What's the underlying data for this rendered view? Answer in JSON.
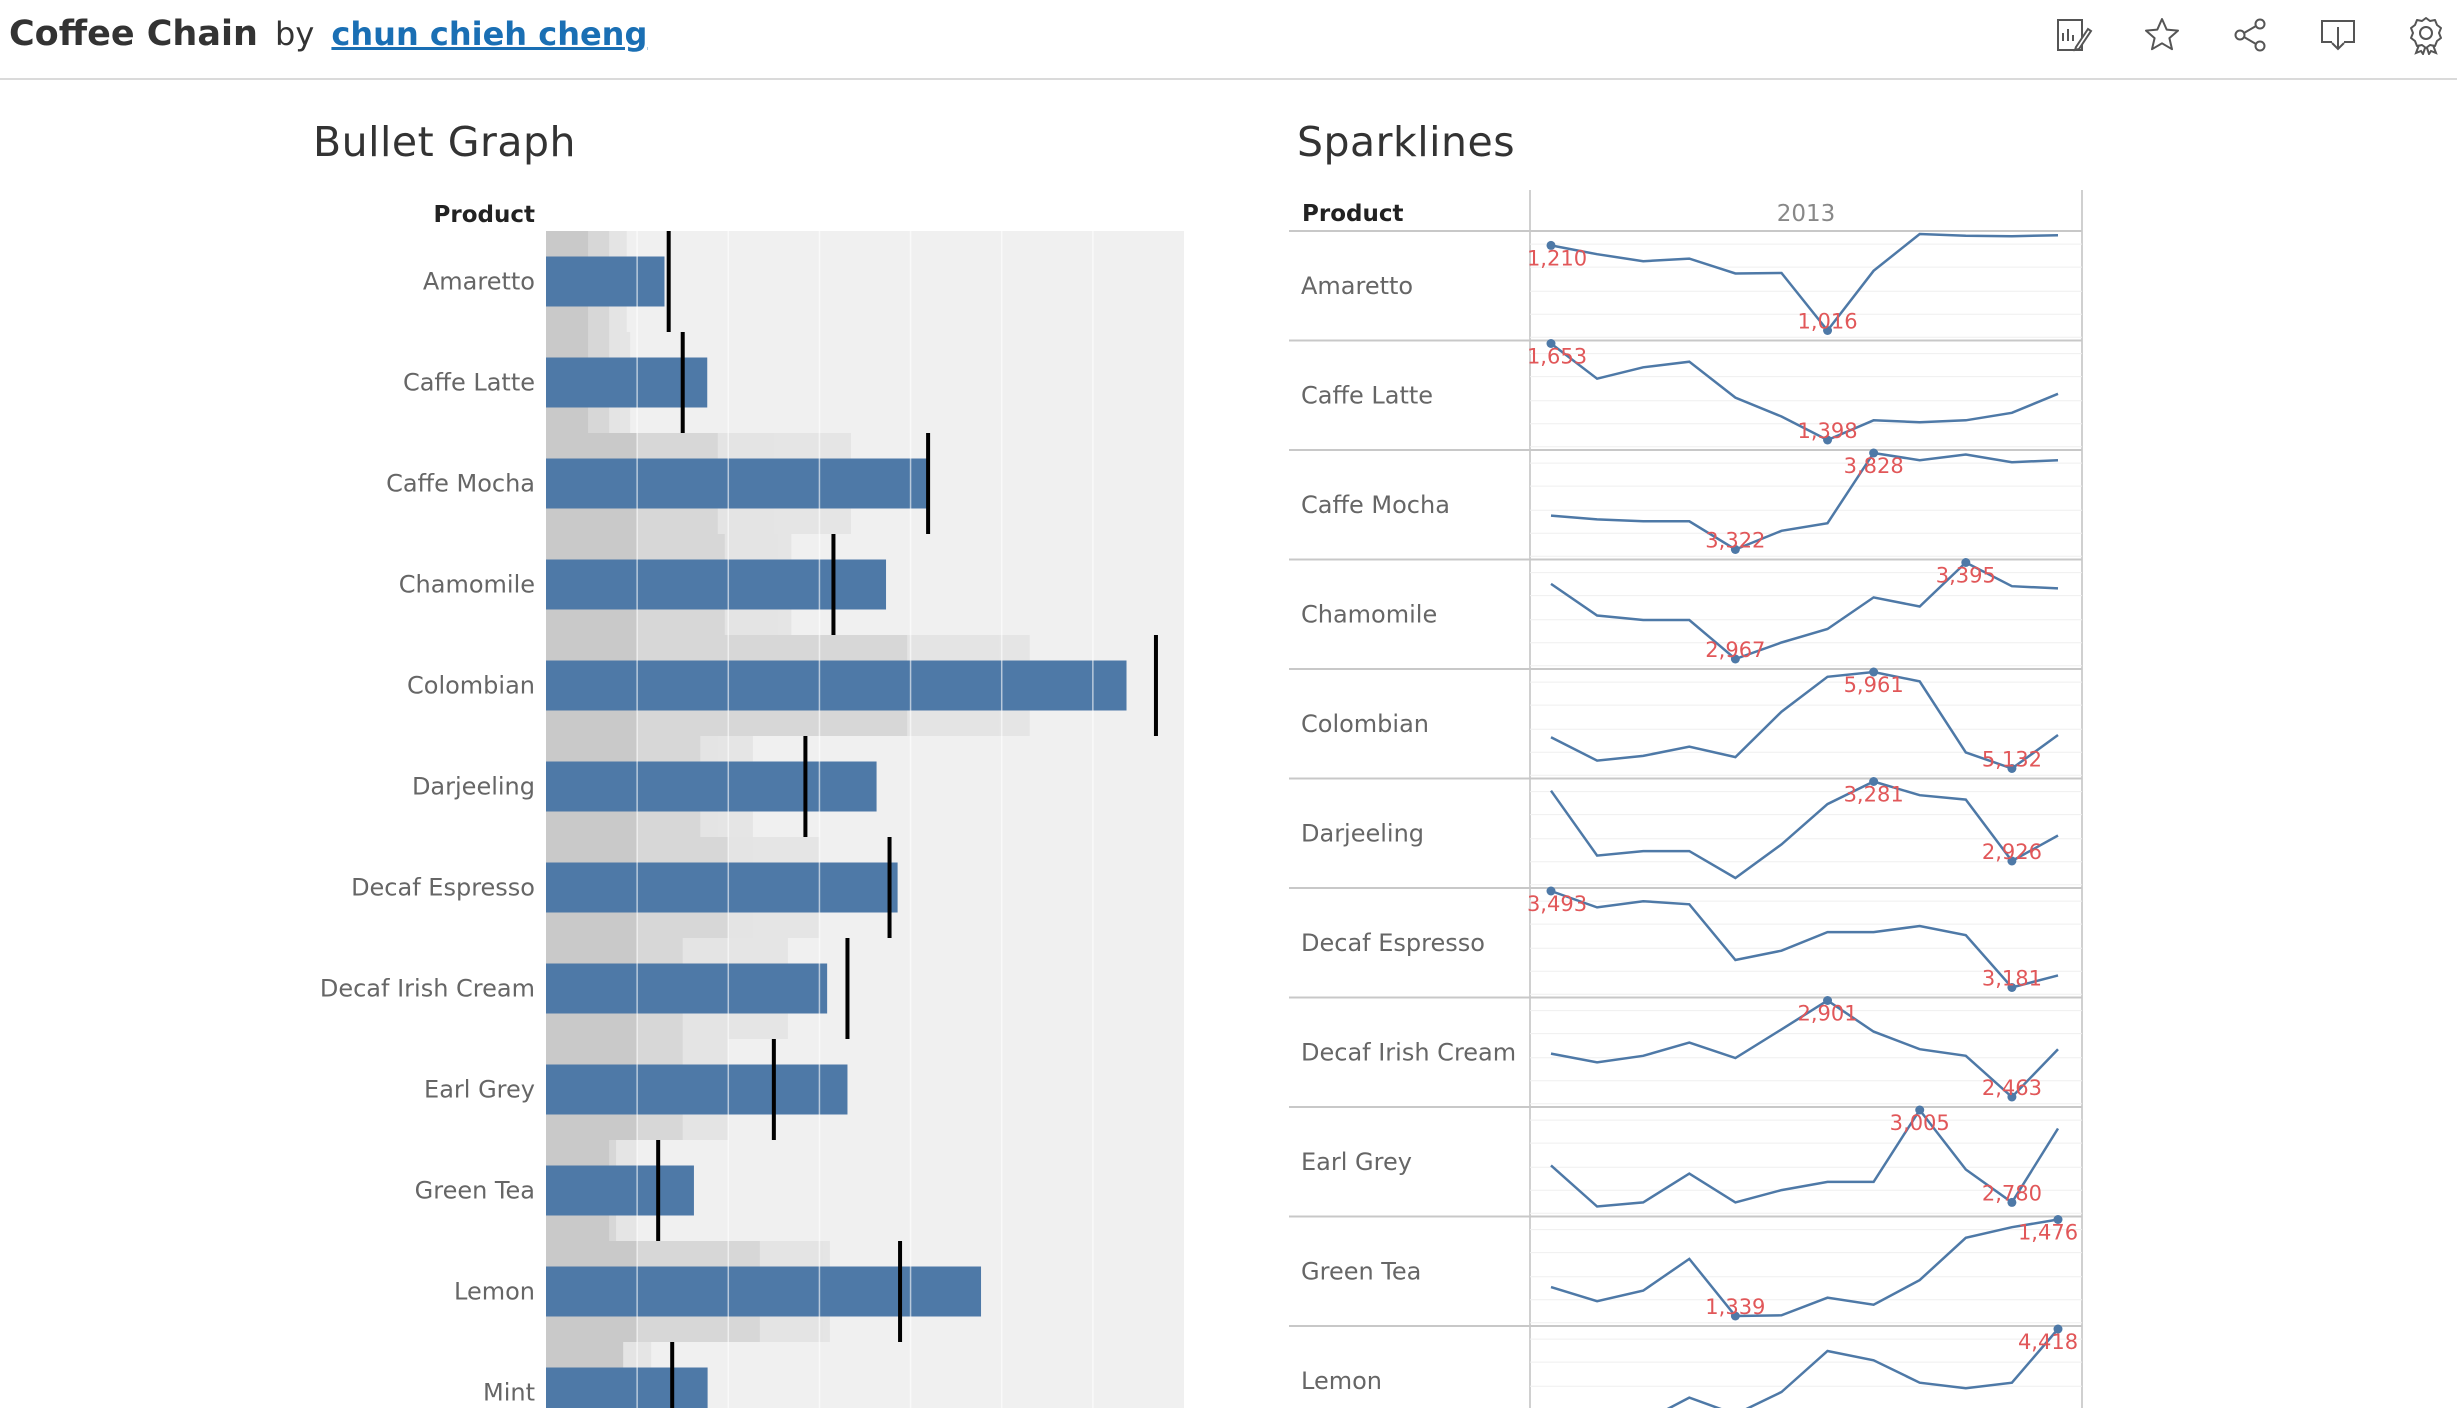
{
  "header": {
    "title": "Coffee Chain",
    "by": "by",
    "author": "chun chieh cheng",
    "tools": [
      "edit-icon",
      "star-icon",
      "share-icon",
      "download-icon",
      "badge-icon"
    ]
  },
  "chart_data": [
    {
      "type": "bar",
      "subtype": "bullet",
      "title": "Bullet Graph",
      "row_header": "Product",
      "categories": [
        "Amaretto",
        "Caffe Latte",
        "Caffe Mocha",
        "Chamomile",
        "Colombian",
        "Darjeeling",
        "Decaf Espresso",
        "Decaf Irish Cream",
        "Earl Grey",
        "Green Tea",
        "Lemon",
        "Mint"
      ],
      "series": [
        {
          "values": [
            33800,
            46000,
            108600,
            97000,
            165600,
            94300,
            100300,
            80200,
            86000,
            42200,
            124100,
            46100
          ]
        }
      ],
      "targets": [
        35000,
        39000,
        109000,
        82000,
        174000,
        74000,
        98000,
        86000,
        65000,
        32000,
        101000,
        36000
      ],
      "bands": [
        [
          12000,
          18000,
          21000,
          23000
        ],
        [
          12000,
          18000,
          21000,
          24000
        ],
        [
          26000,
          49000,
          65000,
          87000
        ],
        [
          26000,
          51000,
          66000,
          70000
        ],
        [
          26000,
          103000,
          129000,
          138000
        ],
        [
          26000,
          44000,
          49000,
          59000
        ],
        [
          26000,
          52000,
          59000,
          78000
        ],
        [
          26000,
          39000,
          52000,
          69000
        ],
        [
          26000,
          39000,
          52000,
          52000
        ],
        [
          18000,
          20000,
          20000,
          26000
        ],
        [
          26000,
          61000,
          79000,
          81000
        ],
        [
          22000,
          22000,
          26000,
          30000
        ]
      ],
      "xlim": [
        0,
        182000
      ],
      "grid": true
    },
    {
      "type": "line",
      "subtype": "sparklines",
      "title": "Sparklines",
      "row_header": "Product",
      "column_header": "2013",
      "x": [
        1,
        2,
        3,
        4,
        5,
        6,
        7,
        8,
        9,
        10,
        11,
        12
      ],
      "series": [
        {
          "values": [
            1210,
            1190,
            1174,
            1180,
            1146,
            1147,
            1016,
            1152,
            1236,
            1232,
            1231,
            1233
          ],
          "min": 1016,
          "max": 1210,
          "min_index": 7,
          "max_index": 1,
          "min_label": "1,016",
          "max_label": "1,210"
        },
        {
          "values": [
            1653,
            1560,
            1590,
            1605,
            1510,
            1460,
            1398,
            1450,
            1445,
            1450,
            1470,
            1520
          ],
          "min": 1398,
          "max": 1653,
          "min_index": 7,
          "max_index": 1,
          "min_label": "1,398",
          "max_label": "1,653"
        },
        {
          "values": [
            3500,
            3480,
            3470,
            3470,
            3322,
            3420,
            3460,
            3828,
            3790,
            3820,
            3780,
            3790
          ],
          "min": 3322,
          "max": 3828,
          "min_index": 5,
          "max_index": 8,
          "min_label": "3,322",
          "max_label": "3,828"
        },
        {
          "values": [
            3300,
            3160,
            3140,
            3140,
            2967,
            3040,
            3100,
            3240,
            3200,
            3395,
            3290,
            3280
          ],
          "min": 2967,
          "max": 3395,
          "min_index": 5,
          "max_index": 10,
          "min_label": "2,967",
          "max_label": "3,395"
        },
        {
          "values": [
            5400,
            5200,
            5240,
            5320,
            5230,
            5620,
            5920,
            5961,
            5880,
            5270,
            5132,
            5420
          ],
          "min": 5132,
          "max": 5961,
          "min_index": 11,
          "max_index": 8,
          "min_label": "5,132",
          "max_label": "5,961"
        },
        {
          "values": [
            3240,
            2950,
            2970,
            2970,
            2850,
            3000,
            3180,
            3281,
            3220,
            3200,
            2926,
            3040
          ],
          "min": 2926,
          "max": 3281,
          "min_index": 11,
          "max_index": 8,
          "min_label": "2,926",
          "max_label": "3,281"
        },
        {
          "values": [
            3493,
            3440,
            3460,
            3450,
            3270,
            3300,
            3360,
            3360,
            3380,
            3350,
            3181,
            3220
          ],
          "min": 3181,
          "max": 3493,
          "min_index": 11,
          "max_index": 1,
          "min_label": "3,181",
          "max_label": "3,493"
        },
        {
          "values": [
            2660,
            2620,
            2650,
            2710,
            2640,
            2770,
            2901,
            2760,
            2680,
            2650,
            2463,
            2680
          ],
          "min": 2463,
          "max": 2901,
          "min_index": 11,
          "max_index": 7,
          "min_label": "2,463",
          "max_label": "2,901"
        },
        {
          "values": [
            2870,
            2770,
            2780,
            2850,
            2780,
            2810,
            2830,
            2830,
            3005,
            2860,
            2780,
            2960
          ],
          "min": 2780,
          "max": 3005,
          "min_index": 11,
          "max_index": 9,
          "min_label": "2,780",
          "max_label": "3,005"
        },
        {
          "values": [
            1380,
            1360,
            1375,
            1420,
            1339,
            1340,
            1365,
            1355,
            1390,
            1450,
            1465,
            1476
          ],
          "min": 1339,
          "max": 1476,
          "min_index": 5,
          "max_index": 12,
          "min_label": "1,339",
          "max_label": "1,476"
        },
        {
          "values": [
            3950,
            3900,
            3920,
            4050,
            3960,
            4080,
            4300,
            4250,
            4130,
            4100,
            4130,
            4418
          ],
          "min": 3900,
          "max": 4418,
          "min_index": 2,
          "max_index": 12,
          "min_label": "",
          "max_label": "4,418"
        }
      ],
      "categories": [
        "Amaretto",
        "Caffe Latte",
        "Caffe Mocha",
        "Chamomile",
        "Colombian",
        "Darjeeling",
        "Decaf Espresso",
        "Decaf Irish Cream",
        "Earl Grey",
        "Green Tea",
        "Lemon"
      ],
      "colors": {
        "line": "#4e79a7",
        "label": "#e15759"
      }
    }
  ],
  "colors": {
    "bar": "#4e79a7",
    "target": "#000000",
    "band_dark": "#c8c8c8",
    "band_mid": "#d6d6d6",
    "band_light": "#e4e4e4",
    "panel_bg": "#f0f0f0",
    "label": "#e15759",
    "spark_line": "#4e79a7"
  }
}
